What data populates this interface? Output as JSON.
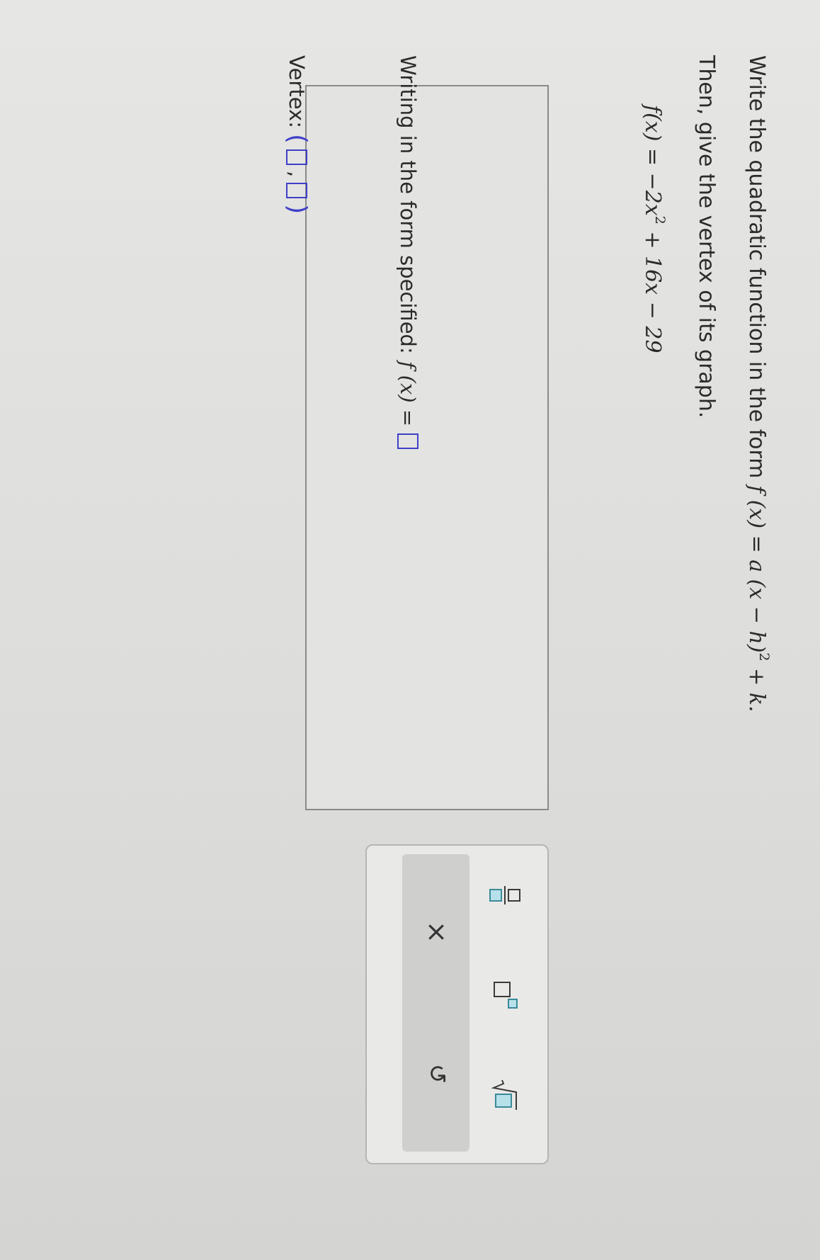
{
  "prompt": {
    "line1_prefix": "Write the quadratic function in the form ",
    "form_lhs": "f (x) = a (x − h)",
    "form_exp": "2",
    "form_rhs": " + k.",
    "line2": "Then, give the vertex of its graph."
  },
  "function": {
    "lhs": "f(x) = −2x",
    "exp": "2",
    "rhs": " + 16x − 29"
  },
  "answer": {
    "form_label": "Writing in the form specified:",
    "form_lhs": "f (x) =",
    "vertex_label": "Vertex:",
    "open_paren": "(",
    "comma": ",",
    "close_paren": ")"
  },
  "palette": {
    "tools": [
      "fraction-icon",
      "exponent-icon",
      "square-root-icon"
    ],
    "clear_label": "×",
    "undo_label": "↺",
    "accent": "#3a8a9a",
    "accent_fill": "#b7e1ea"
  }
}
